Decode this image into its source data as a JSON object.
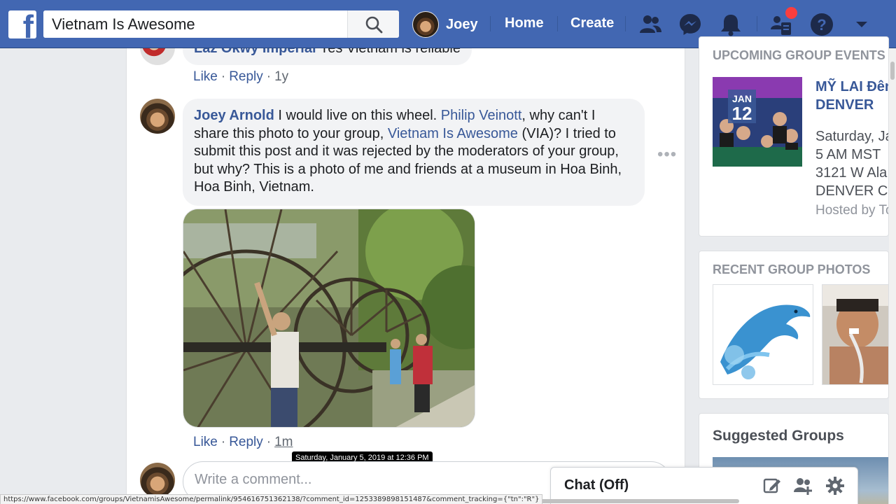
{
  "header": {
    "search_value": "Vietnam Is Awesome",
    "user_name": "Joey",
    "home_label": "Home",
    "create_label": "Create",
    "brand_color": "#4267b2"
  },
  "comments": [
    {
      "author": "Laz Okwy Imperial",
      "text": "Yes Vietnam is reliable",
      "like": "Like",
      "reply": "Reply",
      "time": "1y"
    },
    {
      "author": "Joey Arnold",
      "text_1": "I would live on this wheel.",
      "mention_1": "Philip Veinott",
      "text_2": ", why can't I share this photo to your group,",
      "mention_2": "Vietnam Is Awesome",
      "text_3": "(VIA)? I tried to submit this post and it was rejected by the moderators of your group, but why? This is a photo of me and friends at a museum in Hoa Binh, Hoa Binh, Vietnam.",
      "like": "Like",
      "reply": "Reply",
      "time": "1m",
      "tooltip": "Saturday, January 5, 2019 at 12:36 PM"
    }
  ],
  "comment_box": {
    "placeholder": "Write a comment..."
  },
  "sidebar": {
    "events_heading": "UPCOMING GROUP EVENTS",
    "event": {
      "month": "JAN",
      "day": "12",
      "title_line1": "MỸ LAI Đêm",
      "title_line2": "DENVER",
      "date_line": "Saturday, Ja",
      "time_line": "5 AM MST",
      "address_line": "3121 W Ala",
      "city_line": "DENVER C",
      "host_line": "Hosted by To"
    },
    "photos_heading": "RECENT GROUP PHOTOS",
    "suggested_heading": "Suggested Groups"
  },
  "chat": {
    "label": "Chat (Off)"
  },
  "status_url": "https://www.facebook.com/groups/VietnamisAwesome/permalink/954616751362138/?comment_id=1253389898151487&comment_tracking={\"tn\":\"R\"}"
}
